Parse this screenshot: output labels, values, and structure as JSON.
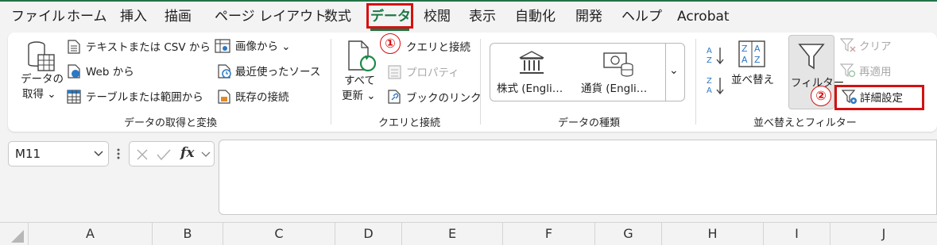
{
  "menu": {
    "tabs": [
      "ファイル",
      "ホーム",
      "挿入",
      "描画",
      "ページ レイアウト",
      "数式",
      "データ",
      "校閲",
      "表示",
      "自動化",
      "開発",
      "ヘルプ",
      "Acrobat"
    ],
    "active_tab": "データ"
  },
  "ribbon": {
    "get_data": {
      "data_button": [
        "データの",
        "取得 ⌄"
      ],
      "from_text_csv": "テキストまたは CSV から",
      "from_web": "Web から",
      "from_table": "テーブルまたは範囲から",
      "from_image": "画像から ⌄",
      "recent_sources": "最近使ったソース",
      "existing_connections": "既存の接続",
      "group_label": "データの取得と変換"
    },
    "queries": {
      "refresh_all": [
        "すべて",
        "更新 ⌄"
      ],
      "queries_connections": "クエリと接続",
      "properties": "プロパティ",
      "edit_links": "ブックのリンク",
      "group_label": "クエリと接続"
    },
    "data_types": {
      "stocks": "株式 (Engli…",
      "currencies": "通貨 (Engli…",
      "more": "⌄",
      "group_label": "データの種類"
    },
    "sort_filter": {
      "sort": "並べ替え",
      "filter": "フィルター",
      "clear": "クリア",
      "reapply": "再適用",
      "advanced": "詳細設定",
      "group_label": "並べ替えとフィルター"
    },
    "annotations": {
      "step1": "①",
      "step2": "②"
    }
  },
  "formula_bar": {
    "name_box": "M11",
    "fx": "fx",
    "formula": ""
  },
  "columns": [
    "A",
    "B",
    "C",
    "D",
    "E",
    "F",
    "G",
    "H",
    "I",
    "J"
  ],
  "colors": {
    "accent": "#217346",
    "highlight": "#d61010",
    "disabled": "#a9a9a9"
  }
}
